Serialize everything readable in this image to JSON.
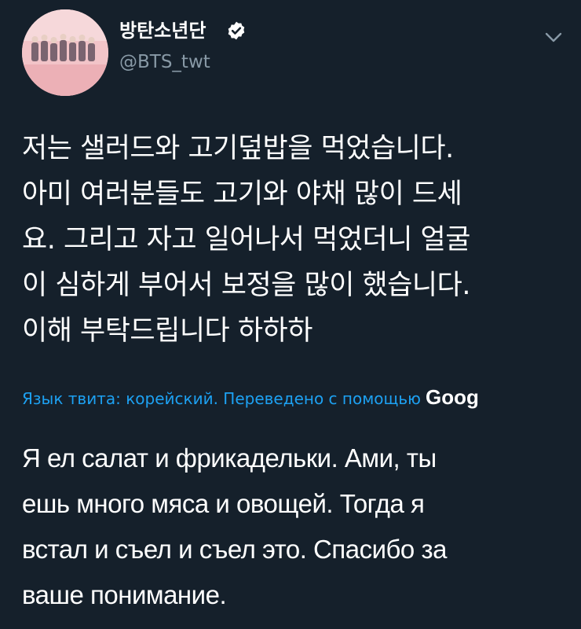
{
  "tweet": {
    "display_name": "방탄소년단",
    "handle": "@BTS_twt",
    "verified": true,
    "text_lines": [
      "저는 샐러드와 고기덮밥을 먹었습니다.",
      "아미 여러분들도 고기와 야채 많이 드세",
      "요. 그리고 자고 일어나서 먹었더니 얼굴",
      "이 심하게 부어서 보정을 많이 했습니다.",
      "이해 부탁드립니다 하하하"
    ],
    "translate_label": "Язык твита: корейский. Переведено с помощью",
    "translate_provider": "Goog",
    "translation_lines": [
      "Я ел салат и фрикадельки. Ами, ты",
      "ешь много мяса и овощей. Тогда я",
      "встал и съел и съел это. Спасибо за",
      "ваше понимание."
    ]
  },
  "icons": {
    "verified": "verified-badge-icon",
    "caret": "chevron-down-icon"
  },
  "colors": {
    "background": "#15202b",
    "text": "#ffffff",
    "secondary_text": "#8899a6",
    "link": "#1da1f2"
  }
}
